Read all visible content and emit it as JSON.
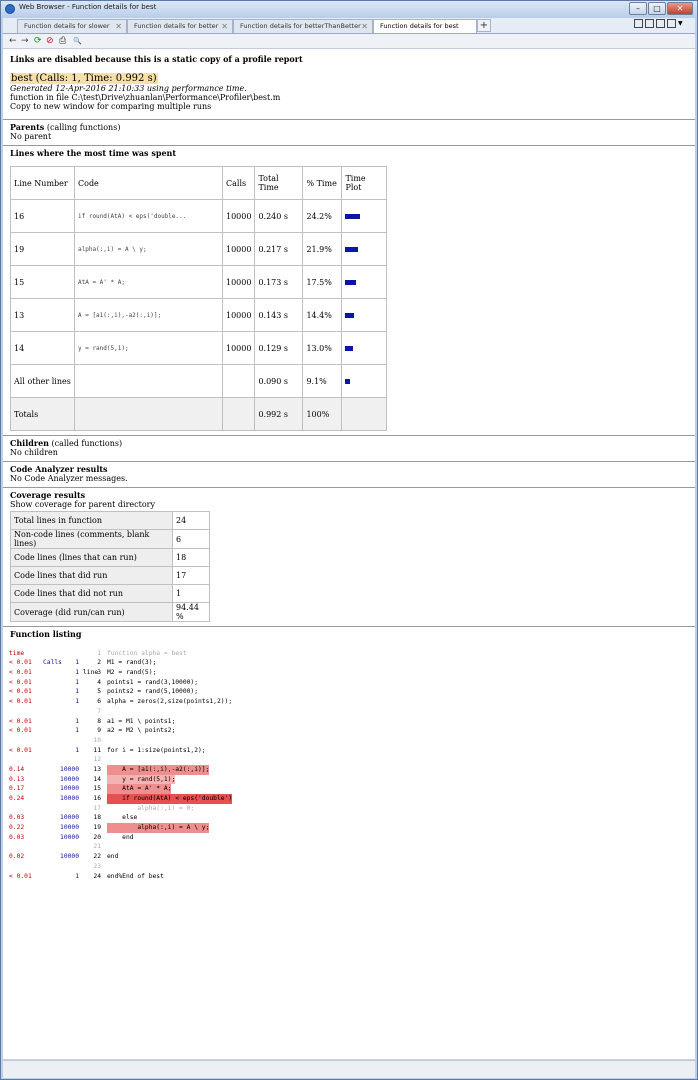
{
  "window": {
    "title": "Web Browser - Function details for best"
  },
  "tabs": [
    {
      "label": "Function details for slower"
    },
    {
      "label": "Function details for better"
    },
    {
      "label": "Function details for betterThanBetter"
    },
    {
      "label": "Function details for best"
    }
  ],
  "toolbar": {
    "back": "←",
    "forward": "→",
    "refresh": "⟳",
    "stop": "⊘",
    "print": "⎙",
    "find": "🔍"
  },
  "page": {
    "notice": "Links are disabled because this is a static copy of a profile report",
    "title": "best (Calls: 1, Time: 0.992 s)",
    "generated": "Generated 12-Apr-2016 21:10:33 using performance time.",
    "file": "function in file C:\\test\\Drive\\zhuanlan\\Performance\\Profiler\\best.m",
    "copy": "Copy to new window for comparing multiple runs"
  },
  "parents": {
    "heading": "Parents",
    "heading_suffix": " (calling functions)",
    "value": "No parent"
  },
  "lines_table": {
    "heading": "Lines where the most time was spent",
    "headers": [
      "Line Number",
      "Code",
      "Calls",
      "Total Time",
      "% Time",
      "Time Plot"
    ],
    "rows": [
      {
        "line": "16",
        "code": "if round(AtA) < eps('double...",
        "calls": "10000",
        "total": "0.240 s",
        "pct": "24.2%",
        "bar": 0.242
      },
      {
        "line": "19",
        "code": "alpha(:,i) = A \\ y;",
        "calls": "10000",
        "total": "0.217 s",
        "pct": "21.9%",
        "bar": 0.219
      },
      {
        "line": "15",
        "code": "AtA = A' * A;",
        "calls": "10000",
        "total": "0.173 s",
        "pct": "17.5%",
        "bar": 0.175
      },
      {
        "line": "13",
        "code": "A = [a1(:,i),-a2(:,i)];",
        "calls": "10000",
        "total": "0.143 s",
        "pct": "14.4%",
        "bar": 0.144
      },
      {
        "line": "14",
        "code": "y = rand(5,1);",
        "calls": "10000",
        "total": "0.129 s",
        "pct": "13.0%",
        "bar": 0.13
      }
    ],
    "other": {
      "label": "All other lines",
      "total": "0.090 s",
      "pct": "9.1%",
      "bar": 0.091
    },
    "totals": {
      "label": "Totals",
      "total": "0.992 s",
      "pct": "100%"
    }
  },
  "children": {
    "heading": "Children",
    "heading_suffix": " (called functions)",
    "value": "No children"
  },
  "analyzer": {
    "heading": "Code Analyzer results",
    "value": "No Code Analyzer messages."
  },
  "coverage": {
    "heading": "Coverage results",
    "link": "Show coverage for parent directory",
    "rows": [
      {
        "label": "Total lines in function",
        "value": "24"
      },
      {
        "label": "Non-code lines (comments, blank lines)",
        "value": "6"
      },
      {
        "label": "Code lines (lines that can run)",
        "value": "18"
      },
      {
        "label": "Code lines that did run",
        "value": "17"
      },
      {
        "label": "Code lines that did not run",
        "value": "1"
      },
      {
        "label": "Coverage (did run/can run)",
        "value": "94.44 %"
      }
    ]
  },
  "listing": {
    "heading": "Function listing",
    "col_time": "time",
    "col_calls": "Calls",
    "col_line": "line",
    "rows": [
      {
        "time": "",
        "calls": "",
        "line": "1",
        "code": "function alpha = best",
        "dim": true,
        "heat": 0
      },
      {
        "time": "< 0.01",
        "calls": "1",
        "line": "2",
        "code": "M1 = rand(3);",
        "dim": false,
        "heat": 0
      },
      {
        "time": "< 0.01",
        "calls": "1",
        "line": "3",
        "code": "M2 = rand(5);",
        "dim": false,
        "heat": 0
      },
      {
        "time": "< 0.01",
        "calls": "1",
        "line": "4",
        "code": "points1 = rand(3,10000);",
        "dim": false,
        "heat": 0
      },
      {
        "time": "< 0.01",
        "calls": "1",
        "line": "5",
        "code": "points2 = rand(5,10000);",
        "dim": false,
        "heat": 0
      },
      {
        "time": "< 0.01",
        "calls": "1",
        "line": "6",
        "code": "alpha = zeros(2,size(points1,2));",
        "dim": false,
        "heat": 0
      },
      {
        "time": "",
        "calls": "",
        "line": "7",
        "code": "",
        "dim": true,
        "heat": 0
      },
      {
        "time": "< 0.01",
        "calls": "1",
        "line": "8",
        "code": "a1 = M1 \\ points1;",
        "dim": false,
        "heat": 0
      },
      {
        "time": "< 0.01",
        "calls": "1",
        "line": "9",
        "code": "a2 = M2 \\ points2;",
        "dim": false,
        "heat": 0
      },
      {
        "time": "",
        "calls": "",
        "line": "10",
        "code": "",
        "dim": true,
        "heat": 0
      },
      {
        "time": "< 0.01",
        "calls": "1",
        "line": "11",
        "code": "for i = 1:size(points1,2);",
        "dim": false,
        "heat": 0
      },
      {
        "time": "",
        "calls": "",
        "line": "12",
        "code": "",
        "dim": true,
        "heat": 0
      },
      {
        "time": "0.14",
        "calls": "10000",
        "line": "13",
        "code": "    A = [a1(:,i),-a2(:,i)];",
        "dim": false,
        "heat": 2
      },
      {
        "time": "0.13",
        "calls": "10000",
        "line": "14",
        "code": "    y = rand(5,1);",
        "dim": false,
        "heat": 1
      },
      {
        "time": "0.17",
        "calls": "10000",
        "line": "15",
        "code": "    AtA = A' * A;",
        "dim": false,
        "heat": 2
      },
      {
        "time": "0.24",
        "calls": "10000",
        "line": "16",
        "code": "    if round(AtA) < eps('double')",
        "dim": false,
        "heat": 3
      },
      {
        "time": "",
        "calls": "",
        "line": "17",
        "code": "        alpha(:,i) = 0;",
        "dim": true,
        "heat": 0
      },
      {
        "time": "0.03",
        "calls": "10000",
        "line": "18",
        "code": "    else",
        "dim": false,
        "heat": 0
      },
      {
        "time": "0.22",
        "calls": "10000",
        "line": "19",
        "code": "        alpha(:,i) = A \\ y;",
        "dim": false,
        "heat": 2
      },
      {
        "time": "0.03",
        "calls": "10000",
        "line": "20",
        "code": "    end",
        "dim": false,
        "heat": 0
      },
      {
        "time": "",
        "calls": "",
        "line": "21",
        "code": "",
        "dim": true,
        "heat": 0
      },
      {
        "time": "0.02",
        "calls": "10000",
        "line": "22",
        "code": "end",
        "dim": false,
        "heat": 0
      },
      {
        "time": "",
        "calls": "",
        "line": "23",
        "code": "",
        "dim": true,
        "heat": 0
      },
      {
        "time": "< 0.01",
        "calls": "1",
        "line": "24",
        "code": "end%End of best",
        "dim": false,
        "heat": 0
      }
    ]
  },
  "colors": {
    "highlight": "#f6dfa9",
    "bar": "#0a14a8",
    "heat1": "#f4b3b3",
    "heat2": "#ef8e8e",
    "heat3": "#e84f4f",
    "time_text": "#c00000",
    "calls_text": "#1010a0"
  }
}
